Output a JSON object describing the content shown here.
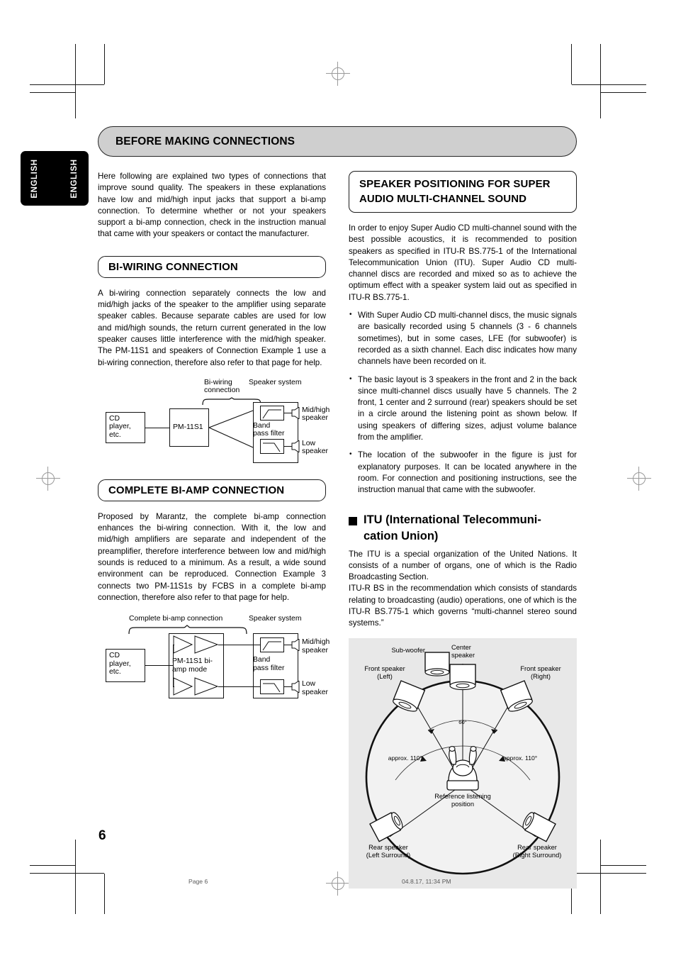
{
  "page": {
    "language_tab": "ENGLISH",
    "page_number": "6",
    "footer_left": "Page 6",
    "footer_right": "04.8.17, 11:34 PM"
  },
  "banner": {
    "title": "BEFORE MAKING CONNECTIONS"
  },
  "intro": {
    "paragraph": "Here following are explained two types of connections that improve sound quality. The speakers in these explanations have low and mid/high input jacks that support a bi-amp connection. To determine whether or not your speakers support a bi-amp connection, check in the instruction manual that came with your speakers or contact the manufacturer."
  },
  "biwiring": {
    "heading": "BI-WIRING CONNECTION",
    "paragraph": "A bi-wiring connection separately connects the low and mid/high jacks of the speaker to the amplifier using separate speaker cables. Because separate cables are used for low and mid/high sounds, the return current generated in the low speaker causes little interference with the mid/high speaker. The PM-11S1 and speakers of Connection Example 1 use a bi-wiring connection, therefore also refer to that page for help.",
    "diagram": {
      "source_label": "CD\nplayer,\netc.",
      "amp_label": "PM-11S1",
      "brace_label": "Bi-wiring\nconnection",
      "speaker_system_label": "Speaker system",
      "filter_label": "Band\npass filter",
      "mid_high_label": "Mid/high\nspeaker",
      "low_label": "Low\nspeaker"
    }
  },
  "biamp": {
    "heading": "COMPLETE BI-AMP CONNECTION",
    "paragraph": "Proposed by Marantz, the complete bi-amp connection enhances the bi-wiring connection. With it, the low and mid/high amplifiers are separate and independent of the preamplifier, therefore interference between low and mid/high sounds is reduced to a minimum. As a result, a wide sound environment can be reproduced. Connection Example 3 connects two PM-11S1s by FCBS in a complete bi-amp connection, therefore also refer to that page for help.",
    "diagram": {
      "source_label": "CD\nplayer,\netc.",
      "amp_label": "PM-11S1 bi-\namp mode",
      "brace_label": "Complete bi-amp connection",
      "speaker_system_label": "Speaker system",
      "filter_label": "Band\npass filter",
      "mid_high_label": "Mid/high\nspeaker",
      "low_label": "Low\nspeaker"
    }
  },
  "speaker_positioning": {
    "heading_line1": "SPEAKER POSITIONING FOR SUPER",
    "heading_line2": "AUDIO MULTI-CHANNEL SOUND",
    "paragraph": "In order to enjoy Super Audio CD multi-channel sound with the best possible acoustics, it is recommended to position speakers as specified in ITU-R BS.775-1 of the International Telecommunication Union (ITU). Super Audio CD multi-channel discs are recorded and mixed so as to achieve the optimum effect with a speaker system laid out as specified in ITU-R BS.775-1.",
    "bullets": [
      "With Super Audio CD multi-channel discs, the music signals are basically recorded using 5 channels (3 - 6 channels sometimes), but in some cases, LFE (for subwoofer) is recorded as a sixth channel. Each disc indicates how many channels have been recorded on it.",
      "The basic layout is 3 speakers in the front and 2 in the back since multi-channel discs usually have 5 channels. The 2 front, 1 center and 2 surround (rear) speakers should be set in a circle around the listening point as shown below. If using speakers of differing sizes, adjust volume balance from the amplifier.",
      "The location of the subwoofer in the figure is just for explanatory purposes. It can be located anywhere in the room. For connection and positioning instructions, see the instruction manual that came with the subwoofer."
    ]
  },
  "itu": {
    "heading_line1": "ITU  (International Telecommuni-",
    "heading_line2": "cation Union)",
    "paragraph1": "The ITU is a special organization of the United Nations.  It consists of a number of organs, one of which is the Radio Broadcasting Section.",
    "paragraph2": "ITU-R BS in the recommendation which consists of standards relating to broadcasting (audio) operations, one of which is the ITU-R BS.775-1 which governs “multi-channel stereo sound systems.”"
  },
  "itu_figure": {
    "subwoofer": "Sub-woofer",
    "center_speaker": "Center\nspeaker",
    "front_left": "Front speaker\n(Left)",
    "front_right": "Front speaker\n(Right)",
    "rear_left": "Rear speaker\n(Left Surround)",
    "rear_right": "Rear speaker\n(Right Surround)",
    "listening_position": "Reference listening\nposition",
    "angle_front": "60°",
    "angle_rear_left": "approx. 110°",
    "angle_rear_right": "approx. 110°"
  }
}
